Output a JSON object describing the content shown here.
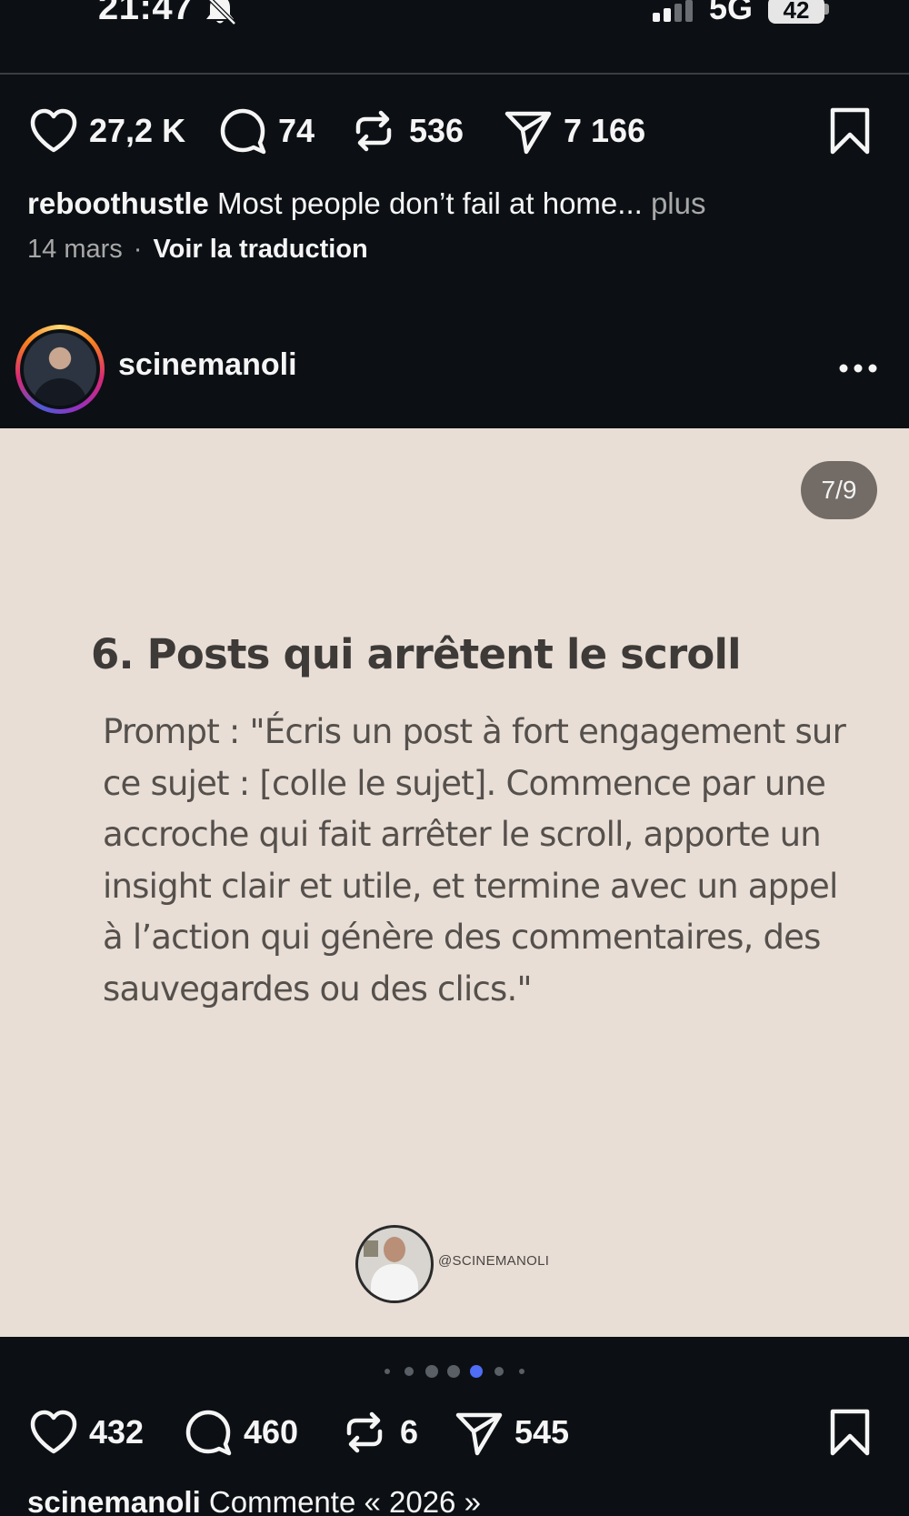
{
  "status_bar": {
    "time": "21:47",
    "network": "5G",
    "battery": "42",
    "icons": [
      "bell-muted-icon",
      "signal-icon"
    ]
  },
  "post1": {
    "actions": {
      "likes": "27,2 K",
      "comments": "74",
      "reposts": "536",
      "shares": "7 166"
    },
    "caption": {
      "username": "reboothustle",
      "text": " Most people don’t fail at home...",
      "more": " plus"
    },
    "date": "14 mars",
    "separator": "·",
    "translate": "Voir la traduction"
  },
  "post2": {
    "username": "scinemanoli",
    "slide": {
      "counter": "7/9",
      "current_index": 5,
      "total_dots_visible": 7,
      "title": "6. Posts qui arrêtent le scroll",
      "body": "Prompt : \"Écris un post à fort engagement sur ce sujet : [colle le sujet]. Commence par une accroche qui fait arrêter le scroll, apporte un insight clair et utile, et termine avec un appel à l’action qui génère des commentaires, des sauvegardes ou des clics.\"",
      "handle": "@SCINEMANOLI"
    },
    "actions": {
      "likes": "432",
      "comments": "460",
      "reposts": "6",
      "shares": "545"
    },
    "caption": {
      "username": "scinemanoli",
      "text": " Commente « 2026 »"
    }
  },
  "colors": {
    "background": "#0c1014",
    "slide_background": "#e8ded6",
    "active_dot": "#4f6df5",
    "muted_text": "#a8a8a8"
  }
}
